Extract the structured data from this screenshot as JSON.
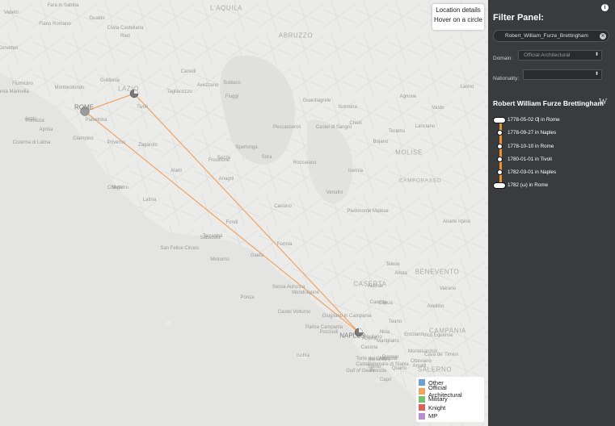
{
  "map": {
    "regions": [
      "L'AQUILA",
      "ABRUZZO",
      "LAZIO",
      "MOLISE",
      "CAMPANIA",
      "BENEVENTO",
      "CASERTA",
      "SALERNO",
      "CAMPOBASSO"
    ],
    "cities": [
      "ROME",
      "NAPLES"
    ],
    "places": [
      "Velletri",
      "Fara in Sabina",
      "Fiano Romano",
      "Gualdo",
      "Rieti",
      "Civita Castellana",
      "Cerveteri",
      "Fiumicino",
      "Santa Marinella",
      "Anzio",
      "Latina",
      "Terracina",
      "Fondi",
      "Formia",
      "Gaeta",
      "Sabaudia",
      "San Felice Circeo",
      "Ponza",
      "Caserta",
      "Frosinone",
      "Cassino",
      "Sora",
      "Avezzano",
      "Tivoli",
      "Sulmona",
      "Pescasseroli",
      "Isernia",
      "Venafro",
      "Piedimonte Matese",
      "Capua",
      "Aversa",
      "Giugliano in Campania",
      "Pozzuoli",
      "Ischia",
      "Capri",
      "Sorrento",
      "Amalfi",
      "Pompei",
      "Castellammare di Stabia",
      "Torre del Greco",
      "Nola",
      "Avellino",
      "Ariano Irpino",
      "Vasto",
      "Lanciano",
      "Chieti",
      "Teramo",
      "Guardiagrele",
      "Agnone",
      "Bojano",
      "Larino",
      "Castel di Sangro",
      "Roccaraso",
      "Tagliacozzo",
      "Carsoli",
      "Subiaco",
      "Fiuggi",
      "Alatri",
      "Anagni",
      "Colleferro",
      "Segni",
      "Monterotondo",
      "Guidonia",
      "Palestrina",
      "Zagarolo",
      "Ciampino",
      "Pomezia",
      "Aprilia",
      "Cisterna di Latina",
      "Priverno",
      "Sezze",
      "Sperlonga",
      "Minturno",
      "Sessa Aurunca",
      "Mondragone",
      "Castel Volturno",
      "Teano",
      "Vairano",
      "Telese",
      "Airola",
      "Montesarchio",
      "Marigliano",
      "Acerra",
      "Afragola",
      "Casoria",
      "Quarto",
      "Procida",
      "Cava de' Tirreni",
      "Nocera",
      "Sarno",
      "Palma Campania",
      "Ottaviano",
      "Ercolano",
      "Vico Equense",
      "Positano",
      "Gulf of Gaeta"
    ],
    "routes": [
      {
        "from": "ROME",
        "to": "Tivoli"
      },
      {
        "from": "Tivoli",
        "to": "NAPLES"
      },
      {
        "from": "ROME",
        "to": "NAPLES"
      }
    ]
  },
  "location_details": {
    "title": "Location details",
    "hint": "Hover on a circle"
  },
  "legend": [
    {
      "label": "Other",
      "color": "#6f9fd1"
    },
    {
      "label": "Official Architectural",
      "color": "#f0a462"
    },
    {
      "label": "Military",
      "color": "#79c06f"
    },
    {
      "label": "Knight",
      "color": "#d9625a"
    },
    {
      "label": "MP",
      "color": "#b590cf"
    }
  ],
  "panel": {
    "title": "Filter Panel:",
    "info_icon": "info-icon",
    "search_value": "Robert_William_Furze_Brettingham",
    "clear_icon": "clear-icon",
    "domain_label": "Domain:",
    "domain_value": "Official Architectural",
    "nationality_label": "Nationality:",
    "nationality_value": "",
    "person_name": "Robert William Furze Brettingham",
    "wiki_icon": "wikipedia-icon",
    "wiki_glyph": "W"
  },
  "timeline": [
    {
      "text": "1778-05-02 Ƣ in Rome",
      "marker": "pill"
    },
    {
      "text": "1778-09-27 in Naples",
      "marker": "dot"
    },
    {
      "text": "1778-10-10 in Rome",
      "marker": "dot"
    },
    {
      "text": "1780-01-01 in Tivoli",
      "marker": "dot"
    },
    {
      "text": "1782-03-01 in Naples",
      "marker": "dot"
    },
    {
      "text": "1782 (ω) in Rome",
      "marker": "pill"
    }
  ],
  "accent_color": "#e8912f"
}
